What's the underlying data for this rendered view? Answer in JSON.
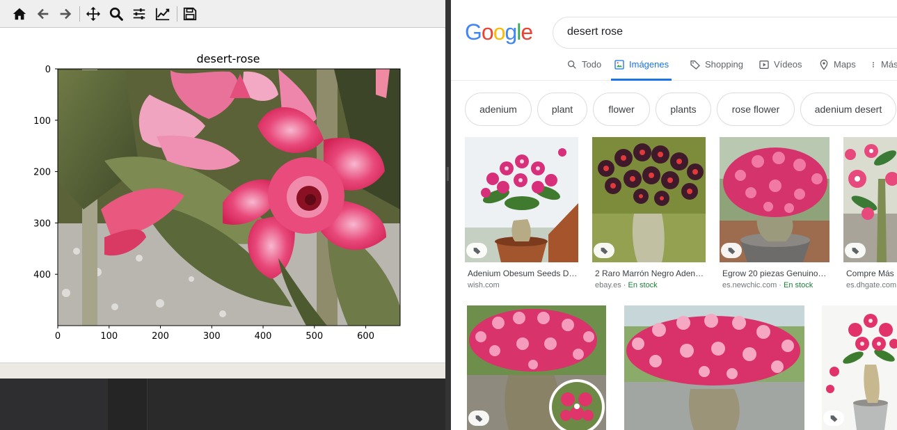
{
  "matplotlib": {
    "toolbar": {
      "home": "home-icon",
      "back": "arrow-left-icon",
      "forward": "arrow-right-icon",
      "pan": "move-icon",
      "zoom": "magnifier-icon",
      "configure": "sliders-icon",
      "edit": "line-chart-icon",
      "save": "floppy-disk-icon"
    },
    "figure": {
      "title": "desert-rose",
      "xticks": [
        "0",
        "100",
        "200",
        "300",
        "400",
        "500",
        "600"
      ],
      "yticks": [
        "0",
        "100",
        "200",
        "300",
        "400"
      ],
      "image_width": 667,
      "image_height": 500
    }
  },
  "google": {
    "logo": [
      "G",
      "o",
      "o",
      "g",
      "l",
      "e"
    ],
    "logo_colors": [
      "#4285f4",
      "#ea4335",
      "#fbbc05",
      "#4285f4",
      "#34a853",
      "#ea4335"
    ],
    "search_query": "desert rose",
    "tabs": [
      {
        "label": "Todo",
        "icon": "search-icon"
      },
      {
        "label": "Imágenes",
        "icon": "image-icon"
      },
      {
        "label": "Shopping",
        "icon": "tag-icon"
      },
      {
        "label": "Vídeos",
        "icon": "play-icon"
      },
      {
        "label": "Maps",
        "icon": "pin-icon"
      },
      {
        "label": "Más",
        "icon": "more-vert-icon"
      }
    ],
    "chips": [
      "adenium",
      "plant",
      "flower",
      "plants",
      "rose flower",
      "adenium desert"
    ],
    "results": [
      {
        "title": "Adenium Obesum Seeds D…",
        "source": "wish.com",
        "stock": ""
      },
      {
        "title": "2 Raro Marrón Negro Aden…",
        "source": "ebay.es · ",
        "stock": "En stock"
      },
      {
        "title": "Egrow 20 piezas Genuino…",
        "source": "es.newchic.com · ",
        "stock": "En stock"
      },
      {
        "title": "Compre Más",
        "source": "es.dhgate.com",
        "stock": ""
      }
    ],
    "accent": "#1a73e8"
  }
}
